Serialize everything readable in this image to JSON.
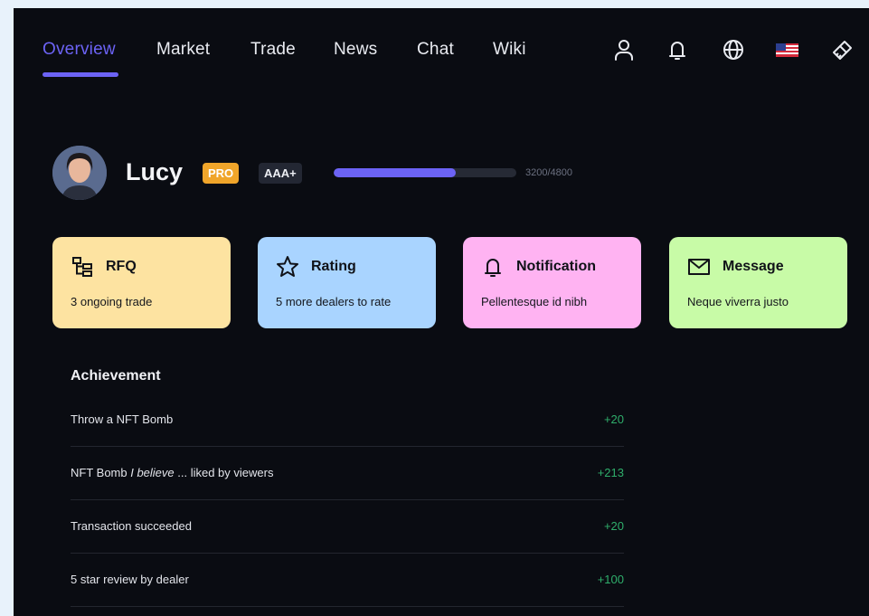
{
  "nav": {
    "tabs": [
      {
        "label": "Overview",
        "active": true
      },
      {
        "label": "Market"
      },
      {
        "label": "Trade"
      },
      {
        "label": "News"
      },
      {
        "label": "Chat"
      },
      {
        "label": "Wiki"
      }
    ],
    "icons": [
      "user-icon",
      "bell-icon",
      "globe-icon",
      "us-flag-icon",
      "brush-icon"
    ]
  },
  "profile": {
    "name": "Lucy",
    "badge_pro": "PRO",
    "badge_rating": "AAA+",
    "progress_text": "3200/4800",
    "progress_fraction": 0.6667
  },
  "cards": [
    {
      "title": "RFQ",
      "subtitle": "3 ongoing trade",
      "icon": "hierarchy-icon",
      "color": "#fde3a1"
    },
    {
      "title": "Rating",
      "subtitle": "5 more dealers to rate",
      "icon": "star-icon",
      "color": "#a9d4ff"
    },
    {
      "title": "Notification",
      "subtitle": "Pellentesque id nibh",
      "icon": "bell-icon",
      "color": "#ffb3f2"
    },
    {
      "title": "Message",
      "subtitle": "Neque viverra justo",
      "icon": "mail-icon",
      "color": "#c8fba7"
    }
  ],
  "achievement": {
    "title": "Achievement",
    "items": [
      {
        "pre": "Throw a NFT Bomb",
        "em": "",
        "post": "",
        "points": "+20"
      },
      {
        "pre": "NFT Bomb ",
        "em": "I believe",
        "post": " ... liked by viewers",
        "points": "+213"
      },
      {
        "pre": "Transaction succeeded",
        "em": "",
        "post": "",
        "points": "+20"
      },
      {
        "pre": "5 star review by dealer",
        "em": "",
        "post": "",
        "points": "+100"
      }
    ]
  },
  "colors": {
    "accent": "#6c63f5",
    "background": "#0a0c12",
    "points_green": "#2fae6b"
  }
}
